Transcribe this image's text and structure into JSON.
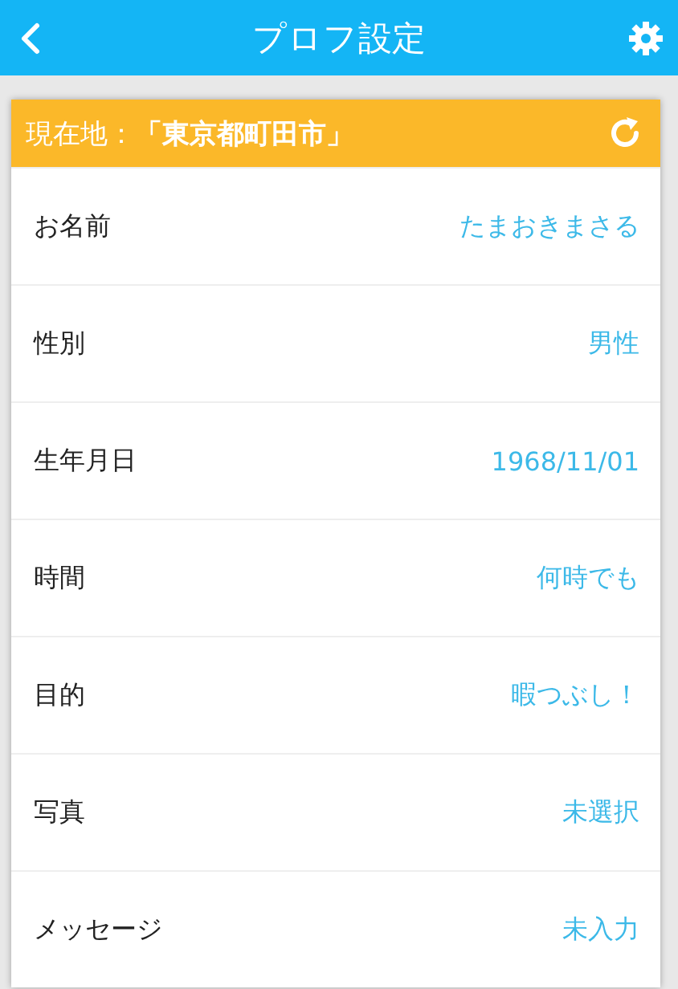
{
  "header": {
    "title": "プロフ設定"
  },
  "location": {
    "text": "現在地：**「東京都町田市」**"
  },
  "rows": [
    {
      "label": "お名前",
      "value": "たまおきまさる"
    },
    {
      "label": "性別",
      "value": "男性"
    },
    {
      "label": "生年月日",
      "value": "1968/11/01"
    },
    {
      "label": "時間",
      "value": "何時でも"
    },
    {
      "label": "目的",
      "value": "暇つぶし！"
    },
    {
      "label": "写真",
      "value": "未選択"
    },
    {
      "label": "メッセージ",
      "value": "未入力"
    }
  ]
}
